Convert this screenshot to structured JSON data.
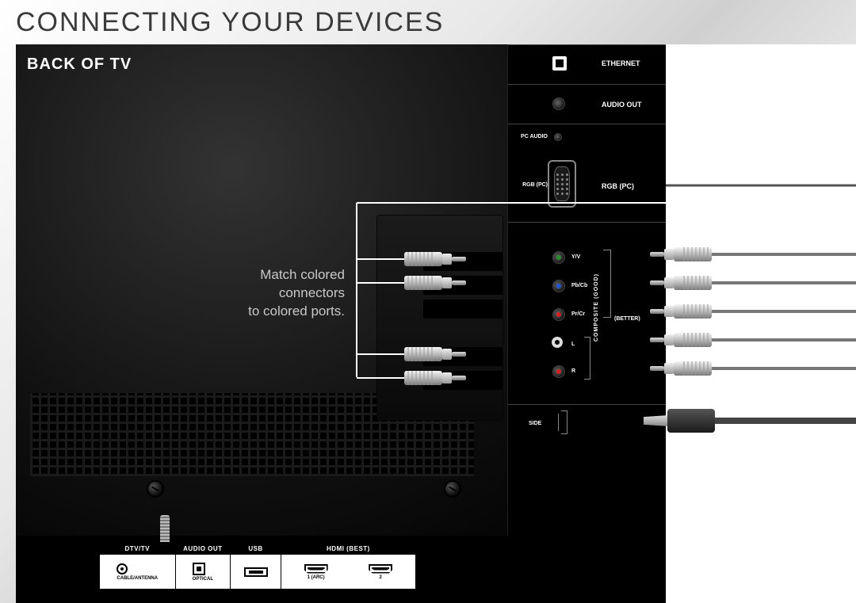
{
  "header": {
    "title": "CONNECTING YOUR DEVICES"
  },
  "panel": {
    "subtitle": "BACK OF TV",
    "instruction_l1": "Match colored",
    "instruction_l2": "connectors",
    "instruction_l3": "to colored ports."
  },
  "side_ports": {
    "ethernet": "ETHERNET",
    "audio_out": "AUDIO OUT",
    "pc_audio": "PC AUDIO",
    "rgb_pc_left": "RGB (PC)",
    "rgb_pc_right": "RGB (PC)",
    "yv": "Y/V",
    "pbcb": "Pb/Cb",
    "prcr": "Pr/Cr",
    "l": "L",
    "r": "R",
    "composite_good": "COMPOSITE (GOOD)",
    "better": "(BETTER)",
    "side": "SIDE"
  },
  "bottom_ports": {
    "dtv_tv": "DTV/TV",
    "cable_antenna": "CABLE/ANTENNA",
    "audio_out": "AUDIO OUT",
    "optical": "OPTICAL",
    "usb": "USB",
    "hdmi_best": "HDMI (BEST)",
    "hdmi_1": "1 (ARC)",
    "hdmi_2": "2"
  }
}
